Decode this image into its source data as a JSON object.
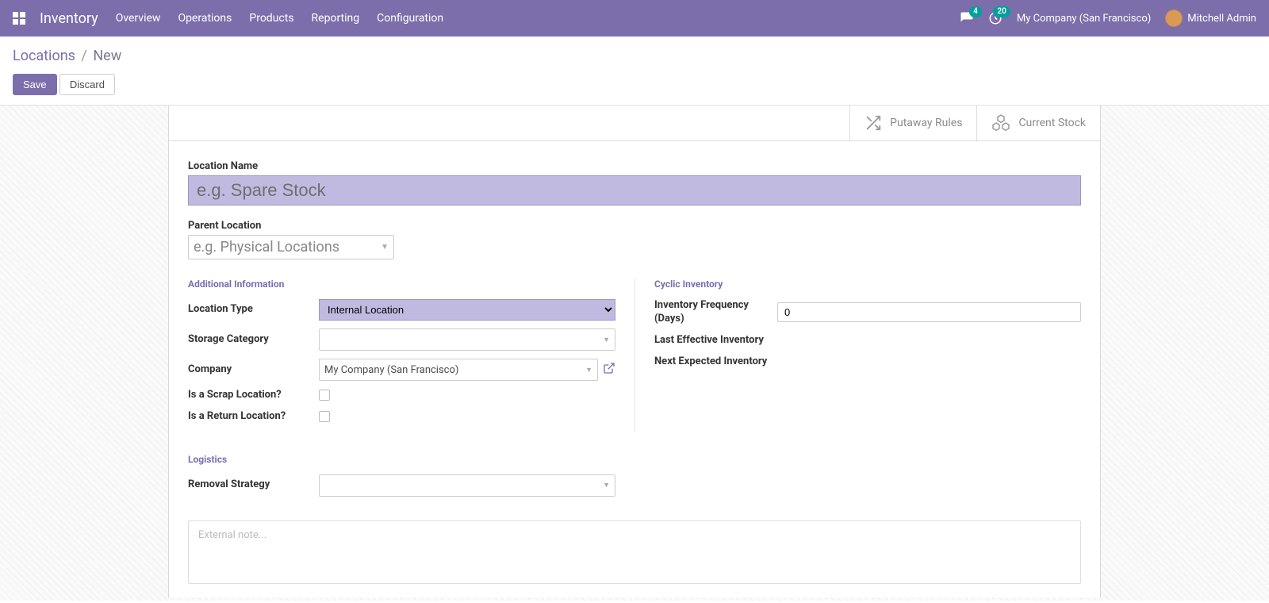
{
  "nav": {
    "app_name": "Inventory",
    "menus": [
      "Overview",
      "Operations",
      "Products",
      "Reporting",
      "Configuration"
    ],
    "chat_badge": "4",
    "activity_badge": "20",
    "company": "My Company (San Francisco)",
    "user": "Mitchell Admin"
  },
  "breadcrumb": {
    "parent": "Locations",
    "current": "New"
  },
  "buttons": {
    "save": "Save",
    "discard": "Discard"
  },
  "stats": {
    "putaway": "Putaway Rules",
    "current_stock": "Current Stock"
  },
  "form": {
    "location_name_label": "Location Name",
    "location_name_placeholder": "e.g. Spare Stock",
    "location_name_value": "",
    "parent_location_label": "Parent Location",
    "parent_location_placeholder": "e.g. Physical Locations",
    "additional_info_title": "Additional Information",
    "location_type_label": "Location Type",
    "location_type_value": "Internal Location",
    "storage_category_label": "Storage Category",
    "storage_category_value": "",
    "company_label": "Company",
    "company_value": "My Company (San Francisco)",
    "is_scrap_label": "Is a Scrap Location?",
    "is_return_label": "Is a Return Location?",
    "cyclic_title": "Cyclic Inventory",
    "inv_freq_label": "Inventory Frequency (Days)",
    "inv_freq_value": "0",
    "last_eff_label": "Last Effective Inventory",
    "next_exp_label": "Next Expected Inventory",
    "logistics_title": "Logistics",
    "removal_label": "Removal Strategy",
    "removal_value": "",
    "note_placeholder": "External note..."
  }
}
